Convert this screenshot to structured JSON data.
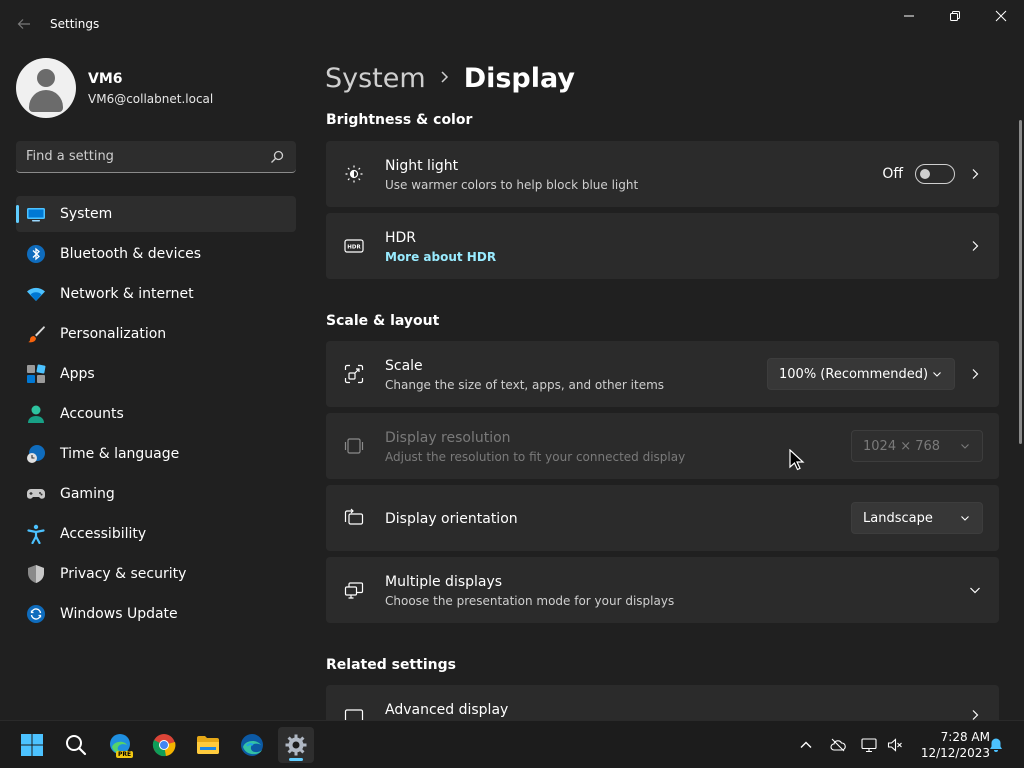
{
  "window": {
    "title": "Settings"
  },
  "profile": {
    "name": "VM6",
    "email": "VM6@collabnet.local"
  },
  "search": {
    "placeholder": "Find a setting"
  },
  "sidebar": {
    "items": [
      {
        "label": "System",
        "icon": "system-icon",
        "active": true
      },
      {
        "label": "Bluetooth & devices",
        "icon": "bluetooth-icon"
      },
      {
        "label": "Network & internet",
        "icon": "wifi-icon"
      },
      {
        "label": "Personalization",
        "icon": "brush-icon"
      },
      {
        "label": "Apps",
        "icon": "apps-icon"
      },
      {
        "label": "Accounts",
        "icon": "person-icon"
      },
      {
        "label": "Time & language",
        "icon": "clock-globe-icon"
      },
      {
        "label": "Gaming",
        "icon": "gamepad-icon"
      },
      {
        "label": "Accessibility",
        "icon": "accessibility-icon"
      },
      {
        "label": "Privacy & security",
        "icon": "shield-icon"
      },
      {
        "label": "Windows Update",
        "icon": "update-icon"
      }
    ]
  },
  "breadcrumb": {
    "parent": "System",
    "current": "Display"
  },
  "sections": {
    "brightness": "Brightness & color",
    "scale_layout": "Scale & layout",
    "related": "Related settings"
  },
  "cards": {
    "night_light": {
      "title": "Night light",
      "subtitle": "Use warmer colors to help block blue light",
      "toggle_state": "Off",
      "toggle_on": false
    },
    "hdr": {
      "title": "HDR",
      "link": "More about HDR"
    },
    "scale": {
      "title": "Scale",
      "subtitle": "Change the size of text, apps, and other items",
      "value": "100% (Recommended)"
    },
    "resolution": {
      "title": "Display resolution",
      "subtitle": "Adjust the resolution to fit your connected display",
      "value": "1024 × 768",
      "disabled": true
    },
    "orientation": {
      "title": "Display orientation",
      "value": "Landscape"
    },
    "multiple": {
      "title": "Multiple displays",
      "subtitle": "Choose the presentation mode for your displays"
    },
    "advanced": {
      "title": "Advanced display"
    }
  },
  "taskbar": {
    "apps": [
      "start-icon",
      "search-icon",
      "edge-preview-icon",
      "chrome-icon",
      "file-explorer-icon",
      "edge-icon",
      "settings-icon"
    ],
    "edge_badge": "PRE",
    "time": "7:28 AM",
    "date": "12/12/2023"
  },
  "colors": {
    "accent": "#60cdff",
    "background": "#202020",
    "card": "#2b2b2b",
    "link": "#99ebff"
  }
}
